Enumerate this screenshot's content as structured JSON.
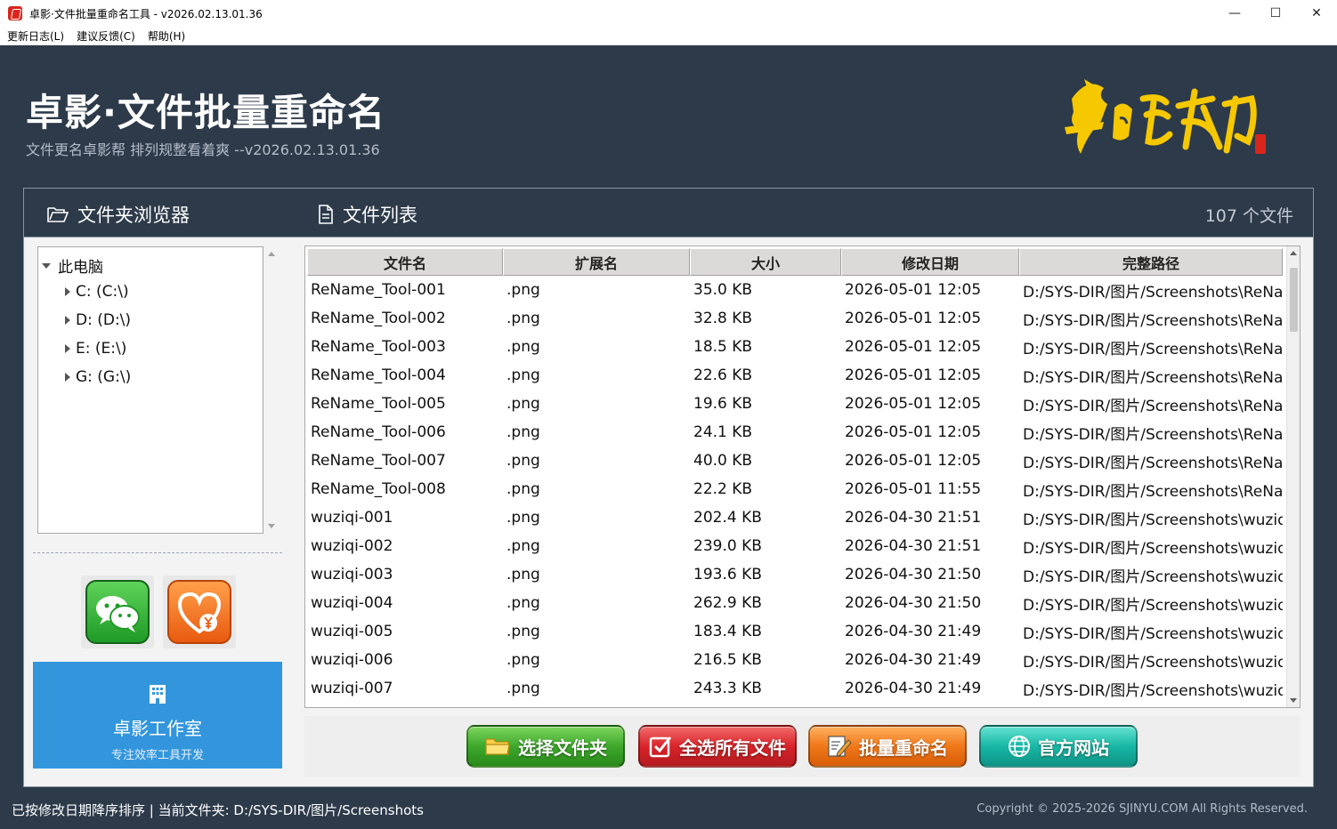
{
  "window": {
    "title": "卓影·文件批量重命名工具 - v2026.02.13.01.36",
    "minimize": "—",
    "maximize": "☐",
    "close": "✕"
  },
  "menu": [
    {
      "label": "更新日志(L)"
    },
    {
      "label": "建议反馈(C)"
    },
    {
      "label": "帮助(H)"
    }
  ],
  "header": {
    "title": "卓影·文件批量重命名",
    "subtitle": "文件更名卓影帮  排列规整看着爽  --v2026.02.13.01.36",
    "logo_text": "马到成功"
  },
  "panels": {
    "folder_browser": "文件夹浏览器",
    "file_list": "文件列表",
    "file_count": "107 个文件"
  },
  "tree": {
    "root": "此电脑",
    "drives": [
      "C: (C:\\)",
      "D: (D:\\)",
      "E: (E:\\)",
      "G: (G:\\)"
    ]
  },
  "studio": {
    "name": "卓影工作室",
    "tagline": "专注效率工具开发"
  },
  "table": {
    "columns": [
      "文件名",
      "扩展名",
      "大小",
      "修改日期",
      "完整路径"
    ],
    "rows": [
      [
        "ReName_Tool-001",
        ".png",
        "35.0 KB",
        "2026-05-01 12:05",
        "D:/SYS-DIR/图片/Screenshots\\ReNar"
      ],
      [
        "ReName_Tool-002",
        ".png",
        "32.8 KB",
        "2026-05-01 12:05",
        "D:/SYS-DIR/图片/Screenshots\\ReNar"
      ],
      [
        "ReName_Tool-003",
        ".png",
        "18.5 KB",
        "2026-05-01 12:05",
        "D:/SYS-DIR/图片/Screenshots\\ReNar"
      ],
      [
        "ReName_Tool-004",
        ".png",
        "22.6 KB",
        "2026-05-01 12:05",
        "D:/SYS-DIR/图片/Screenshots\\ReNar"
      ],
      [
        "ReName_Tool-005",
        ".png",
        "19.6 KB",
        "2026-05-01 12:05",
        "D:/SYS-DIR/图片/Screenshots\\ReNar"
      ],
      [
        "ReName_Tool-006",
        ".png",
        "24.1 KB",
        "2026-05-01 12:05",
        "D:/SYS-DIR/图片/Screenshots\\ReNar"
      ],
      [
        "ReName_Tool-007",
        ".png",
        "40.0 KB",
        "2026-05-01 12:05",
        "D:/SYS-DIR/图片/Screenshots\\ReNar"
      ],
      [
        "ReName_Tool-008",
        ".png",
        "22.2 KB",
        "2026-05-01 11:55",
        "D:/SYS-DIR/图片/Screenshots\\ReNar"
      ],
      [
        "wuziqi-001",
        ".png",
        "202.4 KB",
        "2026-04-30 21:51",
        "D:/SYS-DIR/图片/Screenshots\\wuziq"
      ],
      [
        "wuziqi-002",
        ".png",
        "239.0 KB",
        "2026-04-30 21:51",
        "D:/SYS-DIR/图片/Screenshots\\wuziq"
      ],
      [
        "wuziqi-003",
        ".png",
        "193.6 KB",
        "2026-04-30 21:50",
        "D:/SYS-DIR/图片/Screenshots\\wuziq"
      ],
      [
        "wuziqi-004",
        ".png",
        "262.9 KB",
        "2026-04-30 21:50",
        "D:/SYS-DIR/图片/Screenshots\\wuziq"
      ],
      [
        "wuziqi-005",
        ".png",
        "183.4 KB",
        "2026-04-30 21:49",
        "D:/SYS-DIR/图片/Screenshots\\wuziq"
      ],
      [
        "wuziqi-006",
        ".png",
        "216.5 KB",
        "2026-04-30 21:49",
        "D:/SYS-DIR/图片/Screenshots\\wuziq"
      ],
      [
        "wuziqi-007",
        ".png",
        "243.3 KB",
        "2026-04-30 21:49",
        "D:/SYS-DIR/图片/Screenshots\\wuziq"
      ]
    ]
  },
  "buttons": {
    "select_folder": "选择文件夹",
    "select_all": "全选所有文件",
    "batch_rename": "批量重命名",
    "website": "官方网站"
  },
  "status": {
    "left": "已按修改日期降序排序 | 当前文件夹: D:/SYS-DIR/图片/Screenshots",
    "right": "Copyright © 2025-2026 SJINYU.COM All Rights Reserved."
  },
  "colors": {
    "background": "#2d3a4a",
    "accent_blue": "#3396dc",
    "logo_gold": "#f5c800"
  }
}
